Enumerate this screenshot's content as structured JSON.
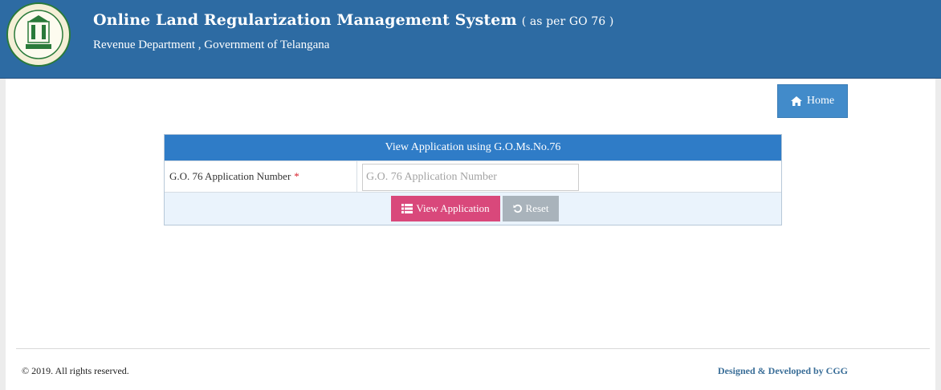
{
  "header": {
    "title": "Online Land Regularization Management System",
    "title_suffix": "( as per GO 76 )",
    "subtitle": "Revenue Department , Government of Telangana",
    "logo_icon": "telangana-emblem-icon"
  },
  "nav": {
    "home_label": "Home",
    "home_icon": "home-icon"
  },
  "form": {
    "heading": "View Application using G.O.Ms.No.76",
    "application_number_label": "G.O. 76 Application Number",
    "required_marker": "*",
    "application_number_placeholder": "G.O. 76 Application Number",
    "application_number_value": "",
    "view_button_label": "View Application",
    "view_button_icon": "list-icon",
    "reset_button_label": "Reset",
    "reset_button_icon": "undo-icon"
  },
  "footer": {
    "copyright": "© 2019. All rights reserved.",
    "credit": "Designed & Developed by CGG"
  },
  "colors": {
    "header_bg": "#2d6ba3",
    "panel_head_bg": "#2f7cc7",
    "view_button": "#d9487b",
    "reset_button": "#a9b3bb",
    "home_button": "#428bca"
  }
}
